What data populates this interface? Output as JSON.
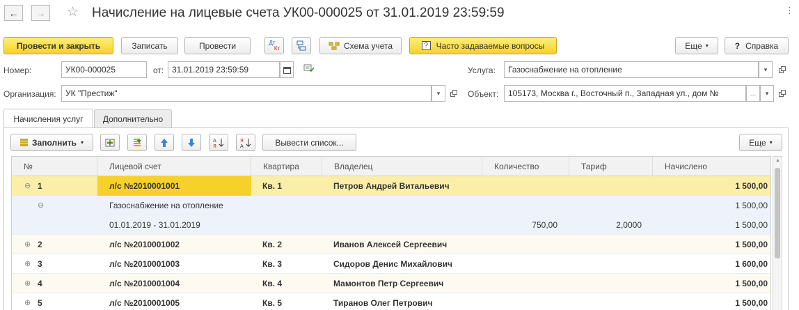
{
  "window": {
    "title": "Начисление на лицевые счета УК00-000025 от 31.01.2019 23:59:59",
    "back_arrow": "←",
    "forward_arrow": "→",
    "star": "☆",
    "controls": [
      "⋮",
      "🔗",
      "□",
      "×"
    ]
  },
  "toolbar": {
    "post_close_label": "Провести и закрыть",
    "save_label": "Записать",
    "post_label": "Провести",
    "dtkt_top": "Дт",
    "dtkt_bottom": "Кт",
    "scheme_label": "Схема учета",
    "faq_label": "Часто задаваемые вопросы",
    "more_label": "Еще",
    "help_label": "Справка"
  },
  "form": {
    "number_label": "Номер:",
    "number_value": "УК00-000025",
    "date_label": "от:",
    "date_value": "31.01.2019 23:59:59",
    "org_label": "Организация:",
    "org_value": "УК \"Престиж\"",
    "service_label": "Услуга:",
    "service_value": "Газоснабжение на отопление",
    "object_label": "Объект:",
    "object_value": "105173, Москва г., Восточный п., Западная ул., дом №"
  },
  "tabs": [
    {
      "label": "Начисления услуг",
      "active": true
    },
    {
      "label": "Дополнительно",
      "active": false
    }
  ],
  "table_toolbar": {
    "fill_label": "Заполнить",
    "export_label": "Вывести список...",
    "more_label": "Еще"
  },
  "table": {
    "columns": [
      "№",
      "Лицевой счет",
      "Квартира",
      "Владелец",
      "Количество",
      "Тариф",
      "Начислено"
    ],
    "rows": [
      {
        "kind": "main",
        "selected": true,
        "toggle": "⊖",
        "num": "1",
        "account": "л/с №2010001001",
        "apt": "Кв. 1",
        "owner": "Петров Андрей Витальевич",
        "qty": "",
        "tariff": "",
        "amount": "1 500,00"
      },
      {
        "kind": "service",
        "toggle": "⊖",
        "num": "",
        "account": "Газоснабжение на отопление",
        "apt": "",
        "owner": "",
        "qty": "",
        "tariff": "",
        "amount": "1 500,00"
      },
      {
        "kind": "period",
        "toggle": "",
        "num": "",
        "account": "01.01.2019 - 31.01.2019",
        "apt": "",
        "owner": "",
        "qty": "750,00",
        "tariff": "2,0000",
        "amount": "1 500,00"
      },
      {
        "kind": "main",
        "selected": false,
        "toggle": "⊕",
        "num": "2",
        "account": "л/с №2010001002",
        "apt": "Кв. 2",
        "owner": "Иванов Алексей Сергеевич",
        "qty": "",
        "tariff": "",
        "amount": "1 500,00"
      },
      {
        "kind": "main",
        "selected": false,
        "toggle": "⊕",
        "num": "3",
        "account": "л/с №2010001003",
        "apt": "Кв. 3",
        "owner": "Сидоров Денис Михайлович",
        "qty": "",
        "tariff": "",
        "amount": "1 600,00"
      },
      {
        "kind": "main",
        "selected": false,
        "toggle": "⊕",
        "num": "4",
        "account": "л/с №2010001004",
        "apt": "Кв. 4",
        "owner": "Мамонтов Петр Сергеевич",
        "qty": "",
        "tariff": "",
        "amount": "1 500,00"
      },
      {
        "kind": "main",
        "selected": false,
        "toggle": "⊕",
        "num": "5",
        "account": "л/с №2010001005",
        "apt": "Кв. 5",
        "owner": "Тиранов Олег Петрович",
        "qty": "",
        "tariff": "",
        "amount": "1 500,00"
      }
    ]
  },
  "colors": {
    "accent_yellow": "#f5d12a",
    "selected_row": "#fbeea8",
    "child_row": "#eef3fb",
    "odd_row": "#fdfbf1"
  }
}
